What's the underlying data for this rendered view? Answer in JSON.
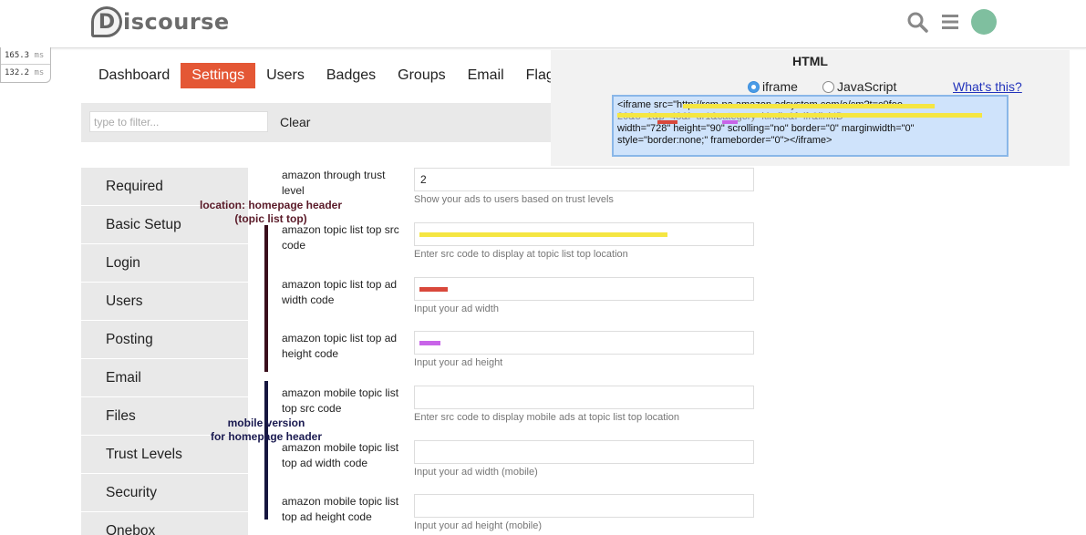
{
  "header": {
    "logo_text": "iscourse",
    "logo_letter": "D",
    "icons": [
      "search-icon",
      "hamburger-menu-icon",
      "user-avatar"
    ]
  },
  "profiler": [
    {
      "value": "165.3",
      "unit": "ms"
    },
    {
      "value": "132.2",
      "unit": "ms"
    }
  ],
  "nav": {
    "items": [
      "Dashboard",
      "Settings",
      "Users",
      "Badges",
      "Groups",
      "Email",
      "Flags"
    ],
    "active": "Settings"
  },
  "filter": {
    "placeholder": "type to filter...",
    "clear_label": "Clear"
  },
  "sidebar": {
    "items": [
      "Required",
      "Basic Setup",
      "Login",
      "Users",
      "Posting",
      "Email",
      "Files",
      "Trust Levels",
      "Security",
      "Onebox"
    ]
  },
  "settings": [
    {
      "label": "amazon through trust level",
      "value": "2",
      "description": "Show your ads to users based on trust levels",
      "stripe": "#f5e642"
    },
    {
      "label": "amazon topic list top src code",
      "value": "",
      "description": "Enter src code to display at topic list top location",
      "stripe": "#f5e642"
    },
    {
      "label": "amazon topic list top ad width code",
      "value": "",
      "description": "Input your ad width",
      "stripe": "#d9483b"
    },
    {
      "label": "amazon topic list top ad height code",
      "value": "",
      "description": "Input your ad height",
      "stripe": "#c864e8"
    },
    {
      "label": "amazon mobile topic list top src code",
      "value": "",
      "description": "Enter src code to display mobile ads at topic list top location",
      "stripe": ""
    },
    {
      "label": "amazon mobile topic list top ad width code",
      "value": "",
      "description": "Input your ad width (mobile)",
      "stripe": ""
    },
    {
      "label": "amazon mobile topic list top ad height code",
      "value": "",
      "description": "Input your ad height (mobile)",
      "stripe": ""
    }
  ],
  "annotations": {
    "homepage": {
      "line1": "location: homepage header",
      "line2": "(topic list top)",
      "color": "#5a1a28"
    },
    "mobile": {
      "line1": "mobile version",
      "line2": "for homepage header",
      "color": "#1a1a50"
    }
  },
  "popup": {
    "title": "HTML",
    "radio_iframe": "iframe",
    "radio_js": "JavaScript",
    "selected": "iframe",
    "whats_this": "What's this?",
    "code_lines": [
      "<iframe src=\"http://rcm-na.amazon-adsystem.com/e/cm?t=c0fee-",
      "20&o=1&p=48&l=ur1&category=kindle&f=ifr&linkID=",
      "width=\"728\" height=\"90\" scrolling=\"no\" border=\"0\" marginwidth=\"0\"",
      "style=\"border:none;\" frameborder=\"0\"></iframe>"
    ],
    "highlight_colors": {
      "yellow": "#f5e642",
      "red": "#d9483b",
      "purple": "#c864e8"
    }
  }
}
